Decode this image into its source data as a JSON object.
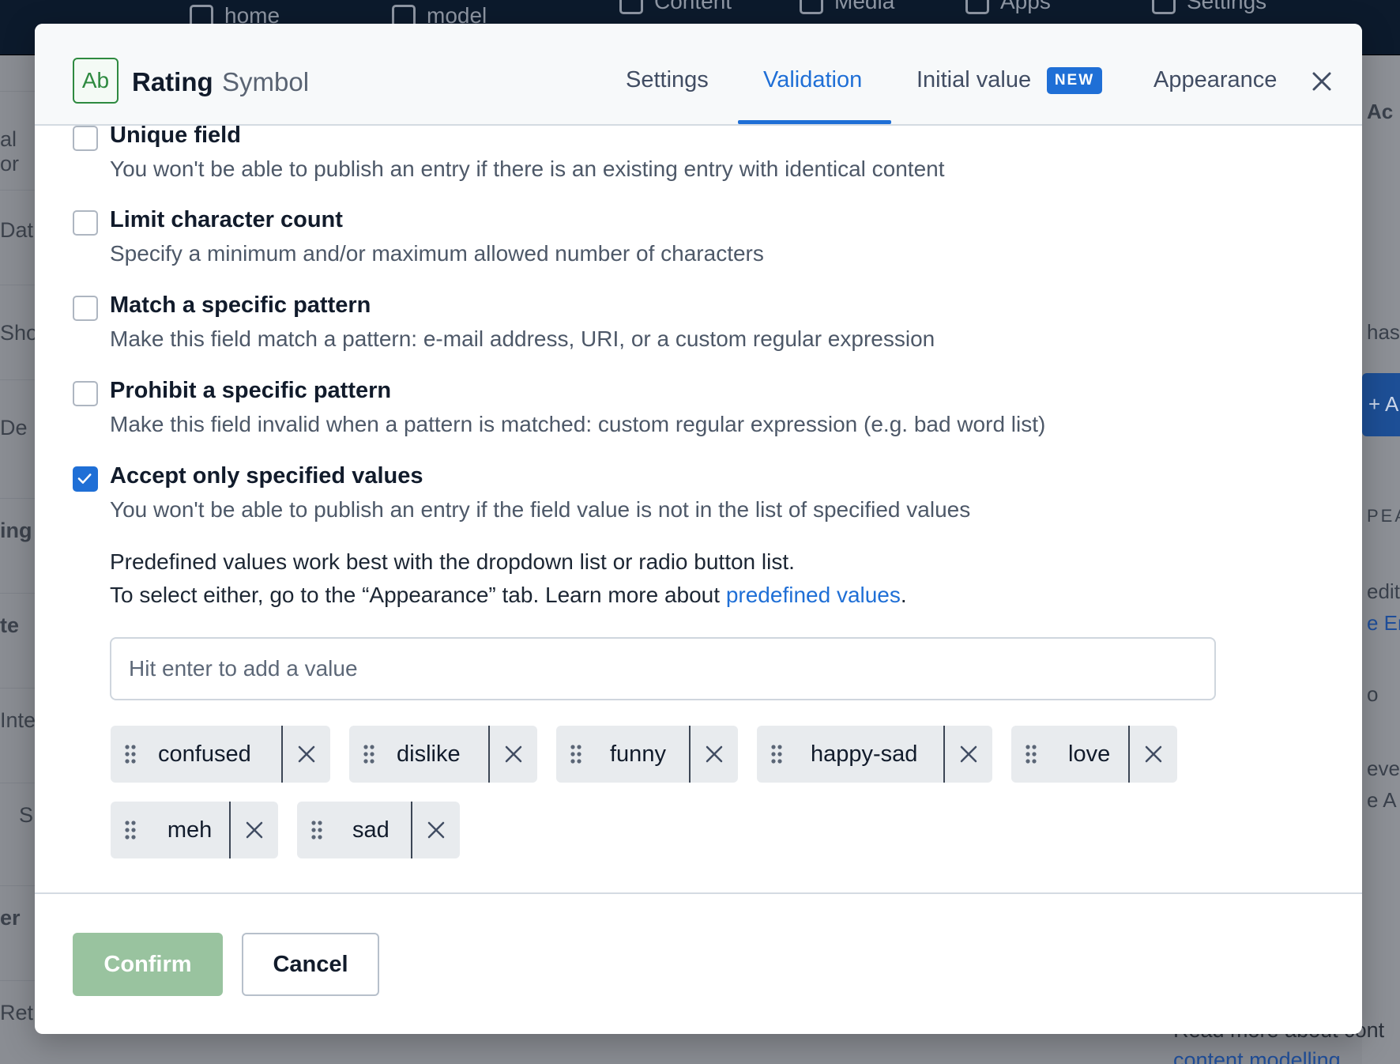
{
  "background": {
    "nav": [
      {
        "label": "home",
        "icon": "home-icon"
      },
      {
        "label": "model",
        "icon": "cube-icon"
      },
      {
        "label": "Content",
        "icon": "edit-icon"
      },
      {
        "label": "Media",
        "icon": "image-icon"
      },
      {
        "label": "Apps",
        "icon": "puzzle-icon"
      },
      {
        "label": "Settings",
        "icon": "gear-icon"
      }
    ],
    "left_labels": [
      "al or",
      "Dat",
      "Sho",
      "De",
      "ing",
      "te",
      "Inte",
      "S",
      "er",
      "Ret"
    ],
    "right_labels": [
      "Ac",
      "has u",
      "+ A",
      "PEA",
      "edito",
      "e Ent",
      "o",
      "eve",
      "e A"
    ],
    "bottom_text": "Read more about cont",
    "bottom_link": "content modelling"
  },
  "modal": {
    "badge": "Ab",
    "field_name": "Rating",
    "field_type": "Symbol",
    "tabs": [
      {
        "label": "Settings",
        "active": false
      },
      {
        "label": "Validation",
        "active": true
      },
      {
        "label": "Initial value",
        "active": false,
        "badge": "NEW"
      },
      {
        "label": "Appearance",
        "active": false
      }
    ],
    "close_icon": "close-icon",
    "accent_color": "#1f6fd6"
  },
  "validations": [
    {
      "title": "Unique field",
      "description": "You won't be able to publish an entry if there is an existing entry with identical content",
      "checked": false
    },
    {
      "title": "Limit character count",
      "description": "Specify a minimum and/or maximum allowed number of characters",
      "checked": false
    },
    {
      "title": "Match a specific pattern",
      "description": "Make this field match a pattern: e-mail address, URI, or a custom regular expression",
      "checked": false
    },
    {
      "title": "Prohibit a specific pattern",
      "description": "Make this field invalid when a pattern is matched: custom regular expression (e.g. bad word list)",
      "checked": false
    },
    {
      "title": "Accept only specified values",
      "description": "You won't be able to publish an entry if the field value is not in the list of specified values",
      "checked": true
    }
  ],
  "predefined": {
    "help_line1": "Predefined values work best with the dropdown list or radio button list.",
    "help_line2_prefix": "To select either, go to the “Appearance” tab. Learn more about ",
    "help_link": "predefined values",
    "help_line2_suffix": ".",
    "input_placeholder": "Hit enter to add a value",
    "input_value": "",
    "values": [
      "confused",
      "dislike",
      "funny",
      "happy-sad",
      "love",
      "meh",
      "sad"
    ]
  },
  "footer": {
    "confirm_label": "Confirm",
    "cancel_label": "Cancel",
    "confirm_color": "#99c39f"
  }
}
